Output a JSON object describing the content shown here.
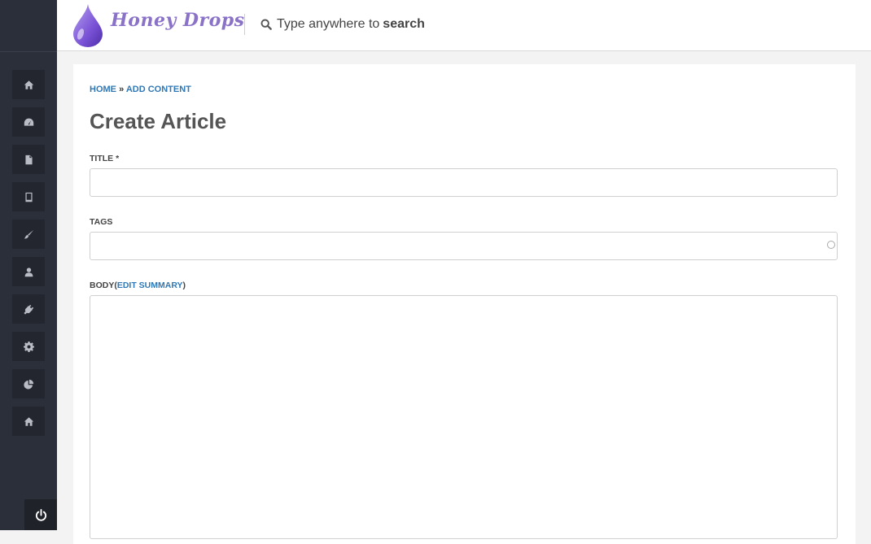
{
  "app": {
    "logo_text": "Honey Drops"
  },
  "search": {
    "prefix": "Type anywhere to",
    "emphasis": "search"
  },
  "sidebar": {
    "items": [
      {
        "icon": "home-icon"
      },
      {
        "icon": "dashboard-icon"
      },
      {
        "icon": "file-icon"
      },
      {
        "icon": "tablet-icon"
      },
      {
        "icon": "brush-icon"
      },
      {
        "icon": "user-icon"
      },
      {
        "icon": "plug-icon"
      },
      {
        "icon": "gear-icon"
      },
      {
        "icon": "pie-chart-icon"
      },
      {
        "icon": "home-icon"
      }
    ],
    "footer_icon": "power-icon"
  },
  "breadcrumb": {
    "home": "HOME",
    "sep": "»",
    "current": "ADD CONTENT"
  },
  "page": {
    "title": "Create Article"
  },
  "form": {
    "title_label": "TITLE",
    "required_mark": "*",
    "title_value": "",
    "tags_label": "TAGS",
    "tags_value": "",
    "body_label": "BODY",
    "body_paren_open": "(",
    "body_edit_summary": "EDIT SUMMARY",
    "body_paren_close": ")",
    "body_value": ""
  },
  "colors": {
    "sidebar": "#2b2f3a",
    "accent": "#2f78b5",
    "logo": "#8b72c9"
  }
}
